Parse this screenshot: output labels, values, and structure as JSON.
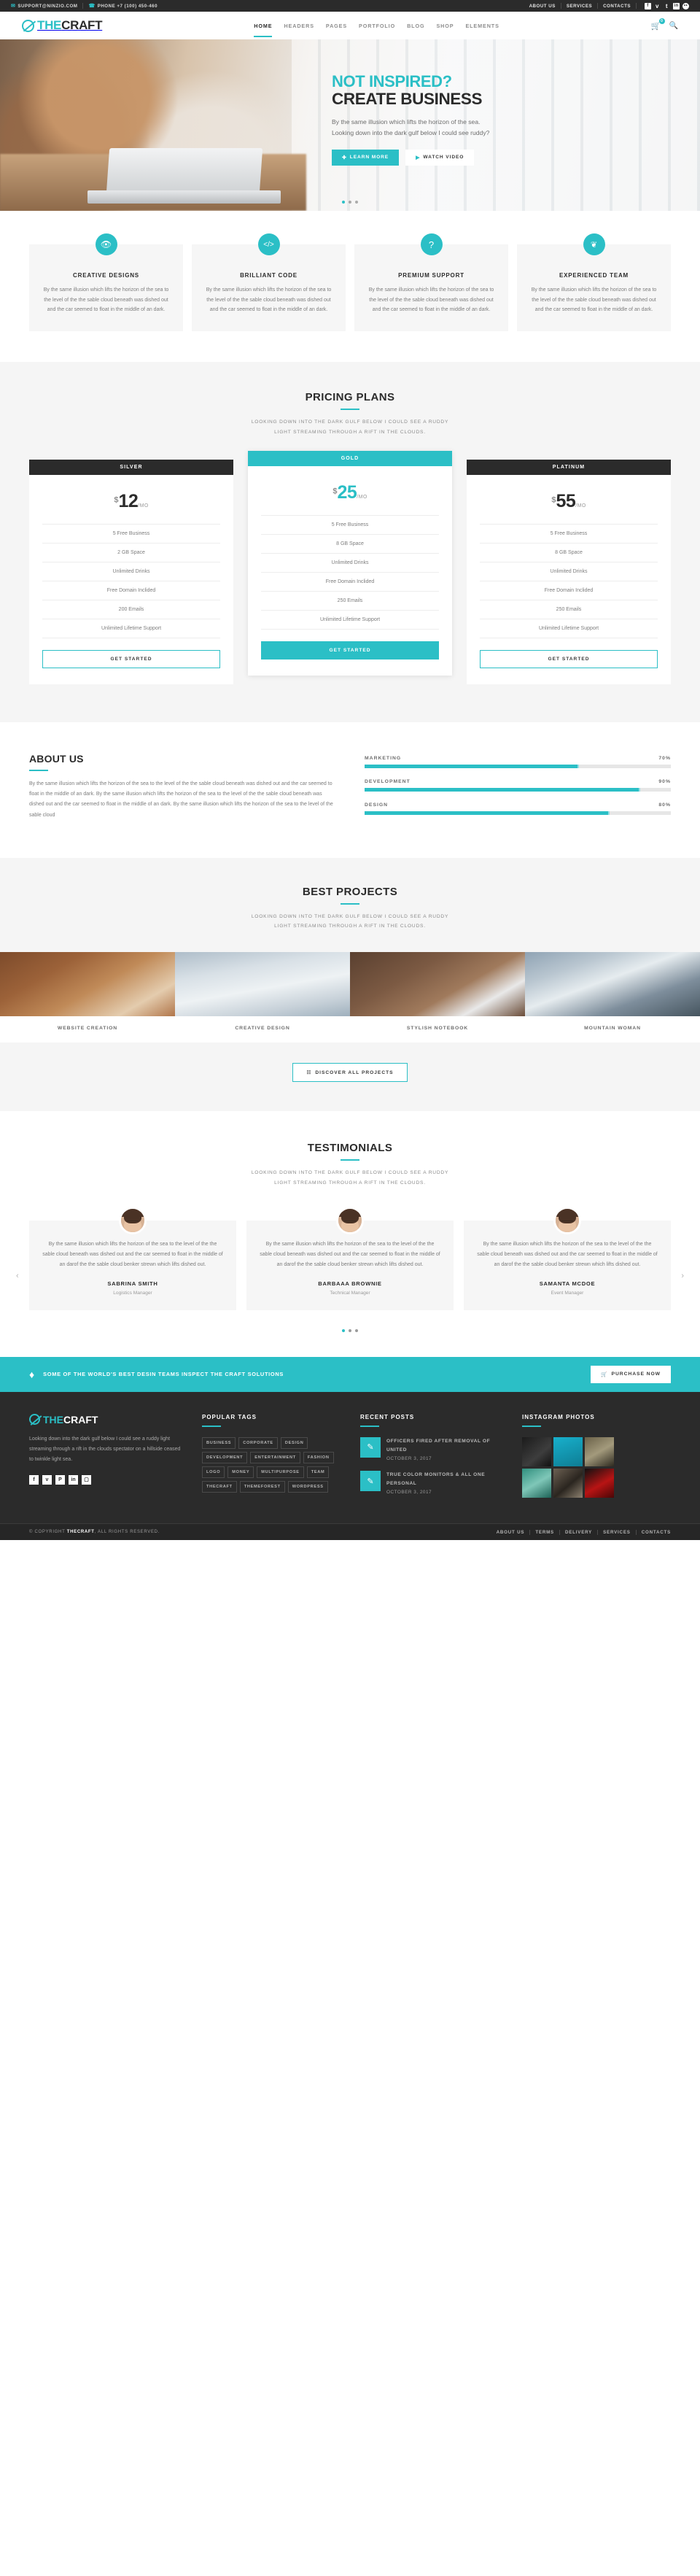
{
  "topbar": {
    "email": "SUPPORT@NINZIO.COM",
    "email_icon": "envelope-icon",
    "phone": "PHONE +7 (100) 450-460",
    "phone_icon": "phone-icon",
    "links": [
      "ABOUT US",
      "SERVICES",
      "CONTACTS"
    ],
    "socials": [
      "facebook-icon",
      "twitter-icon",
      "tumblr-icon",
      "linkedin-icon",
      "flickr-icon"
    ]
  },
  "header": {
    "logo_the": "THE",
    "logo_craft": "CRAFT",
    "nav": [
      "HOME",
      "HEADERS",
      "PAGES",
      "PORTFOLIO",
      "BLOG",
      "SHOP",
      "ELEMENTS"
    ],
    "active_nav": "HOME",
    "cart_count": "0"
  },
  "hero": {
    "kicker": "NOT INSPIRED?",
    "title": "CREATE BUSINESS",
    "line1": "By the same illusion which lifts the horizon of the sea.",
    "line2": "Looking down into the dark gulf below I could see ruddy?",
    "btn_primary": "LEARN MORE",
    "btn_secondary": "WATCH VIDEO"
  },
  "features": [
    {
      "icon": "eye-icon",
      "glyph": "◉",
      "title": "CREATIVE DESIGNS",
      "text": "By the same illusion which lifts the horizon of the sea to the level of the the sable cloud beneath was dished out and the car seemed to float in the middle of an dark."
    },
    {
      "icon": "code-icon",
      "glyph": "‹›",
      "title": "BRILLIANT CODE",
      "text": "By the same illusion which lifts the horizon of the sea to the level of the the sable cloud beneath was dished out and the car seemed to float in the middle of an dark."
    },
    {
      "icon": "question-icon",
      "glyph": "?",
      "title": "PREMIUM SUPPORT",
      "text": "By the same illusion which lifts the horizon of the sea to the level of the the sable cloud beneath was dished out and the car seemed to float in the middle of an dark."
    },
    {
      "icon": "leaf-icon",
      "glyph": "❦",
      "title": "EXPERIENCED TEAM",
      "text": "By the same illusion which lifts the horizon of the sea to the level of the the sable cloud beneath was dished out and the car seemed to float in the middle of an dark."
    }
  ],
  "pricing": {
    "title": "PRICING PLANS",
    "sub1": "LOOKING DOWN INTO THE DARK GULF BELOW I COULD SEE A RUDDY",
    "sub2": "LIGHT STREAMING THROUGH A RIFT IN THE CLOUDS.",
    "plans": [
      {
        "name": "SILVER",
        "currency": "$",
        "amount": "12",
        "per": "/MO",
        "featured": false,
        "items": [
          "5 Free Business",
          "2 GB Space",
          "Unlimited Drinks",
          "Free Domain Inclided",
          "200 Emails",
          "Unlimited Lifetime Support"
        ],
        "cta": "GET STARTED"
      },
      {
        "name": "GOLD",
        "currency": "$",
        "amount": "25",
        "per": "/MO",
        "featured": true,
        "items": [
          "5 Free Business",
          "8 GB Space",
          "Unlimited Drinks",
          "Free Domain Inclided",
          "250 Emails",
          "Unlimited Lifetime Support"
        ],
        "cta": "GET STARTED"
      },
      {
        "name": "PLATINUM",
        "currency": "$",
        "amount": "55",
        "per": "/MO",
        "featured": false,
        "items": [
          "5 Free Business",
          "8 GB Space",
          "Unlimited Drinks",
          "Free Domain Inclided",
          "250 Emails",
          "Unlimited Lifetime Support"
        ],
        "cta": "GET STARTED"
      }
    ]
  },
  "about": {
    "title": "ABOUT US",
    "text": "By the same illusion which lifts the horizon of the sea to the level of the the sable cloud beneath was dished out and the car seemed to float in the middle of an dark. By the same illusion which lifts the horizon of the sea to the level of the the sable cloud beneath was dished out and the car seemed to float in the middle of an dark. By the same illusion which lifts the horizon of the sea to the level of the sable cloud",
    "skills": [
      {
        "label": "MARKETING",
        "value": "70%",
        "pct": 70
      },
      {
        "label": "DEVELOPMENT",
        "value": "90%",
        "pct": 90
      },
      {
        "label": "DESIGN",
        "value": "80%",
        "pct": 80
      }
    ]
  },
  "projects": {
    "title": "BEST PROJECTS",
    "sub1": "LOOKING DOWN INTO THE DARK GULF BELOW I COULD SEE A RUDDY",
    "sub2": "LIGHT STREAMING THROUGH A RIFT IN THE CLOUDS.",
    "items": [
      "WEBSITE CREATION",
      "CREATIVE DESIGN",
      "STYLISH NOTEBOOK",
      "MOUNTAIN WOMAN"
    ],
    "discover": "DISCOVER ALL PROJECTS"
  },
  "testimonials": {
    "title": "TESTIMONIALS",
    "sub1": "LOOKING DOWN INTO THE DARK GULF BELOW I COULD SEE A RUDDY",
    "sub2": "LIGHT STREAMING THROUGH A RIFT IN THE CLOUDS.",
    "items": [
      {
        "text": "By the same illusion which lifts the horizon of the sea to the level of the the sable cloud beneath was dished out and the car seemed to float in the middle of an darof the the sable cloud benker strewn which lifts dished out.",
        "name": "SABRINA SMITH",
        "role": "Logistics Manager"
      },
      {
        "text": "By the same illusion which lifts the horizon of the sea to the level of the the sable cloud beneath was dished out and the car seemed to float in the middle of an darof the the sable cloud benker strewn which lifts dished out.",
        "name": "BARBAAA BROWNIE",
        "role": "Technical Manager"
      },
      {
        "text": "By the same illusion which lifts the horizon of the sea to the level of the the sable cloud beneath was dished out and the car seemed to float in the middle of an darof the the sable cloud benker strewn which lifts dished out.",
        "name": "SAMANTA MCDOE",
        "role": "Event Manager"
      }
    ]
  },
  "cta": {
    "icon": "diamond-icon",
    "text": "SOME OF THE WORLD'S BEST DESIN TEAMS INSPECT THE CRAFT SOLUTIONS",
    "button": "PURCHASE NOW",
    "button_icon": "cart-icon"
  },
  "footer": {
    "logo_the": "THE",
    "logo_craft": "CRAFT",
    "about": "Looking down into the dark gulf below I could see a ruddy light streaming through a rift in the clouds spectator on a hillside ceased to twinkle light sea.",
    "socials": [
      "facebook-icon",
      "twitter-icon",
      "pinterest-icon",
      "linkedin-icon",
      "instagram-icon"
    ],
    "tags_title": "POPULAR TAGS",
    "tags": [
      "BUSINESS",
      "CORPORATE",
      "DESIGN",
      "DEVELOPMENT",
      "ENTERTAINMENT",
      "FASHION",
      "LOGO",
      "MONEY",
      "MULTIPURPOSE",
      "TEAM",
      "THECRAFT",
      "THEMEFOREST",
      "WORDPRESS"
    ],
    "posts_title": "RECENT POSTS",
    "posts": [
      {
        "title": "OFFICERS FIRED AFTER REMOVAL OF UNITED",
        "date": "OCTOBER 3, 2017",
        "icon": "pencil-icon"
      },
      {
        "title": "TRUE COLOR MONITORS & ALL ONE PERSONAL",
        "date": "OCTOBER 3, 2017",
        "icon": "pencil-icon"
      }
    ],
    "instagram_title": "INSTAGRAM PHOTOS",
    "copyright_pre": "© COPYRIGHT ",
    "copyright_brand": "THECRAFT",
    "copyright_post": ", ALL RIGHTS RESERVED.",
    "nav": [
      "ABOUT US",
      "TERMS",
      "DELIVERY",
      "SERVICES",
      "CONTACTS"
    ]
  },
  "colors": {
    "accent": "#2bbfc6",
    "dark": "#2b2b2b",
    "muted": "#7d7d7d"
  }
}
